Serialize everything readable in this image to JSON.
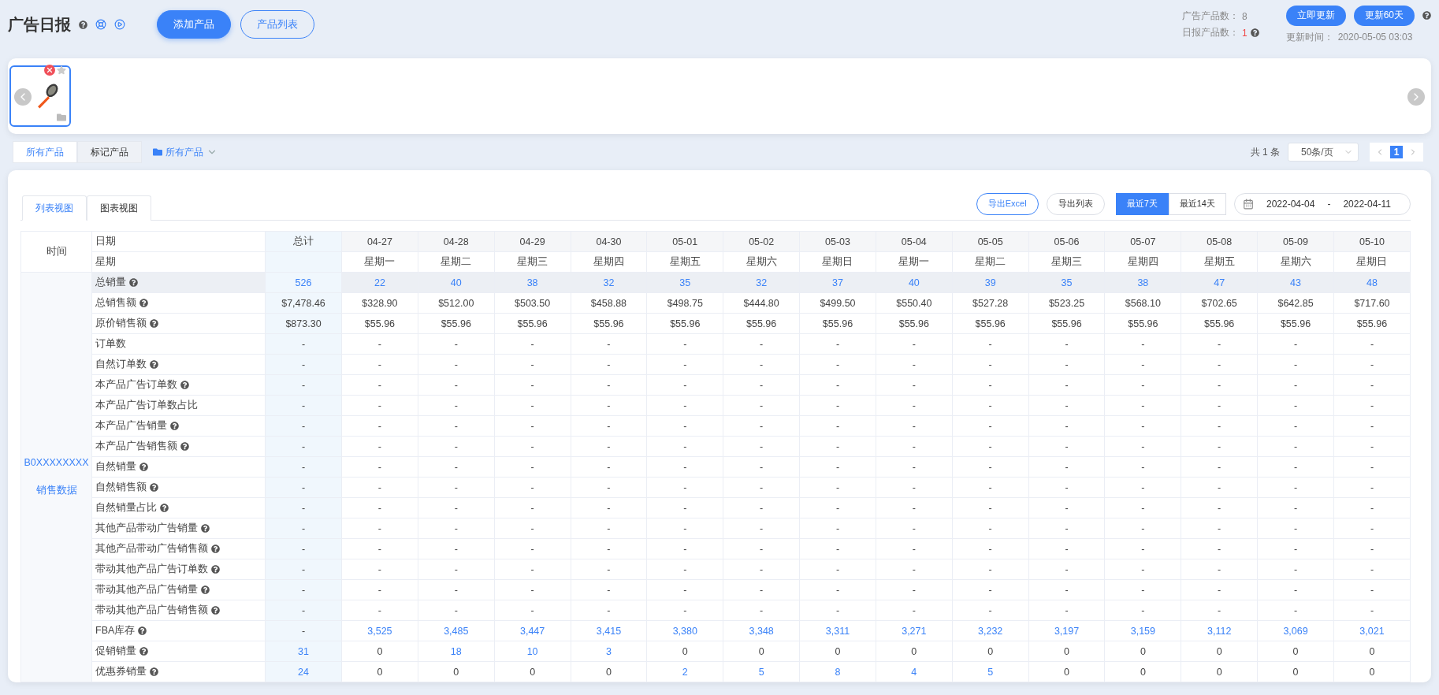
{
  "header": {
    "title": "广告日报",
    "buttons": [
      {
        "label": "添加产品",
        "primary": true
      },
      {
        "label": "产品列表",
        "primary": false
      }
    ],
    "stats": [
      {
        "label": "广告产品数：",
        "value": "8",
        "alert": false,
        "help": false
      },
      {
        "label": "日报产品数：",
        "value": "1",
        "alert": true,
        "help": true
      }
    ],
    "actions": [
      "立即更新",
      "更新60天"
    ],
    "update_label": "更新时间：",
    "update_time": "2020-05-05 03:03"
  },
  "products": [
    {
      "selected": true,
      "starred": false
    }
  ],
  "filter": {
    "tabs": [
      {
        "label": "所有产品",
        "selected": true
      },
      {
        "label": "标记产品",
        "selected": false
      }
    ],
    "folder": "所有产品",
    "total": "共 1 条",
    "page_size": "50条/页",
    "pages": [
      {
        "label": "1",
        "selected": true
      }
    ]
  },
  "view": {
    "tabs": [
      {
        "label": "列表视图",
        "selected": true
      },
      {
        "label": "图表视图",
        "selected": false
      }
    ],
    "exports": [
      {
        "label": "导出Excel",
        "primary": true
      },
      {
        "label": "导出列表",
        "primary": false
      }
    ],
    "ranges": [
      {
        "label": "最近7天",
        "selected": true
      },
      {
        "label": "最近14天",
        "selected": false
      }
    ],
    "date_start": "2022-04-04",
    "date_separator": "-",
    "date_end": "2022-04-11"
  },
  "table": {
    "corner": "时间",
    "date_label": "日期",
    "weekday_label": "星期",
    "total_label": "总计",
    "dates": [
      "04-27",
      "04-28",
      "04-29",
      "04-30",
      "05-01",
      "05-02",
      "05-03",
      "05-04",
      "05-05",
      "05-06",
      "05-07",
      "05-08",
      "05-09",
      "05-10"
    ],
    "weekdays": [
      "星期一",
      "星期二",
      "星期三",
      "星期四",
      "星期五",
      "星期六",
      "星期日",
      "星期一",
      "星期二",
      "星期三",
      "星期四",
      "星期五",
      "星期六",
      "星期日"
    ],
    "group": {
      "product": "B0XXXXXXXX",
      "label": "销售数据"
    },
    "rows": [
      {
        "label": "总销量",
        "help": true,
        "highlight": true,
        "cells": [
          "526",
          "22",
          "40",
          "38",
          "32",
          "35",
          "32",
          "37",
          "40",
          "39",
          "35",
          "38",
          "47",
          "43",
          "48"
        ],
        "linked": [
          true,
          true,
          true,
          true,
          true,
          true,
          true,
          true,
          true,
          true,
          true,
          true,
          true,
          true,
          true
        ]
      },
      {
        "label": "总销售额",
        "help": true,
        "highlight": false,
        "cells": [
          "$7,478.46",
          "$328.90",
          "$512.00",
          "$503.50",
          "$458.88",
          "$498.75",
          "$444.80",
          "$499.50",
          "$550.40",
          "$527.28",
          "$523.25",
          "$568.10",
          "$702.65",
          "$642.85",
          "$717.60"
        ]
      },
      {
        "label": "原价销售额",
        "help": true,
        "highlight": false,
        "cells": [
          "$873.30",
          "$55.96",
          "$55.96",
          "$55.96",
          "$55.96",
          "$55.96",
          "$55.96",
          "$55.96",
          "$55.96",
          "$55.96",
          "$55.96",
          "$55.96",
          "$55.96",
          "$55.96",
          "$55.96"
        ]
      },
      {
        "label": "订单数",
        "help": false,
        "highlight": false,
        "cells": [
          "-",
          "-",
          "-",
          "-",
          "-",
          "-",
          "-",
          "-",
          "-",
          "-",
          "-",
          "-",
          "-",
          "-",
          "-"
        ]
      },
      {
        "label": "自然订单数",
        "help": true,
        "highlight": false,
        "cells": [
          "-",
          "-",
          "-",
          "-",
          "-",
          "-",
          "-",
          "-",
          "-",
          "-",
          "-",
          "-",
          "-",
          "-",
          "-"
        ]
      },
      {
        "label": "本产品广告订单数",
        "help": true,
        "highlight": false,
        "cells": [
          "-",
          "-",
          "-",
          "-",
          "-",
          "-",
          "-",
          "-",
          "-",
          "-",
          "-",
          "-",
          "-",
          "-",
          "-"
        ]
      },
      {
        "label": "本产品广告订单数占比",
        "help": false,
        "highlight": false,
        "cells": [
          "-",
          "-",
          "-",
          "-",
          "-",
          "-",
          "-",
          "-",
          "-",
          "-",
          "-",
          "-",
          "-",
          "-",
          "-"
        ]
      },
      {
        "label": "本产品广告销量",
        "help": true,
        "highlight": false,
        "cells": [
          "-",
          "-",
          "-",
          "-",
          "-",
          "-",
          "-",
          "-",
          "-",
          "-",
          "-",
          "-",
          "-",
          "-",
          "-"
        ]
      },
      {
        "label": "本产品广告销售额",
        "help": true,
        "highlight": false,
        "cells": [
          "-",
          "-",
          "-",
          "-",
          "-",
          "-",
          "-",
          "-",
          "-",
          "-",
          "-",
          "-",
          "-",
          "-",
          "-"
        ]
      },
      {
        "label": "自然销量",
        "help": true,
        "highlight": false,
        "cells": [
          "-",
          "-",
          "-",
          "-",
          "-",
          "-",
          "-",
          "-",
          "-",
          "-",
          "-",
          "-",
          "-",
          "-",
          "-"
        ]
      },
      {
        "label": "自然销售额",
        "help": true,
        "highlight": false,
        "cells": [
          "-",
          "-",
          "-",
          "-",
          "-",
          "-",
          "-",
          "-",
          "-",
          "-",
          "-",
          "-",
          "-",
          "-",
          "-"
        ]
      },
      {
        "label": "自然销量占比",
        "help": true,
        "highlight": false,
        "cells": [
          "-",
          "-",
          "-",
          "-",
          "-",
          "-",
          "-",
          "-",
          "-",
          "-",
          "-",
          "-",
          "-",
          "-",
          "-"
        ]
      },
      {
        "label": "其他产品带动广告销量",
        "help": true,
        "highlight": false,
        "cells": [
          "-",
          "-",
          "-",
          "-",
          "-",
          "-",
          "-",
          "-",
          "-",
          "-",
          "-",
          "-",
          "-",
          "-",
          "-"
        ]
      },
      {
        "label": "其他产品带动广告销售额",
        "help": true,
        "highlight": false,
        "cells": [
          "-",
          "-",
          "-",
          "-",
          "-",
          "-",
          "-",
          "-",
          "-",
          "-",
          "-",
          "-",
          "-",
          "-",
          "-"
        ]
      },
      {
        "label": "带动其他产品广告订单数",
        "help": true,
        "highlight": false,
        "cells": [
          "-",
          "-",
          "-",
          "-",
          "-",
          "-",
          "-",
          "-",
          "-",
          "-",
          "-",
          "-",
          "-",
          "-",
          "-"
        ]
      },
      {
        "label": "带动其他产品广告销量",
        "help": true,
        "highlight": false,
        "cells": [
          "-",
          "-",
          "-",
          "-",
          "-",
          "-",
          "-",
          "-",
          "-",
          "-",
          "-",
          "-",
          "-",
          "-",
          "-"
        ]
      },
      {
        "label": "带动其他产品广告销售额",
        "help": true,
        "highlight": false,
        "cells": [
          "-",
          "-",
          "-",
          "-",
          "-",
          "-",
          "-",
          "-",
          "-",
          "-",
          "-",
          "-",
          "-",
          "-",
          "-"
        ]
      },
      {
        "label": "FBA库存",
        "help": true,
        "highlight": false,
        "cells": [
          "-",
          "3,525",
          "3,485",
          "3,447",
          "3,415",
          "3,380",
          "3,348",
          "3,311",
          "3,271",
          "3,232",
          "3,197",
          "3,159",
          "3,112",
          "3,069",
          "3,021"
        ],
        "linked": [
          false,
          true,
          true,
          true,
          true,
          true,
          true,
          true,
          true,
          true,
          true,
          true,
          true,
          true,
          true
        ]
      },
      {
        "label": "促销销量",
        "help": true,
        "highlight": false,
        "cells": [
          "31",
          "0",
          "18",
          "10",
          "3",
          "0",
          "0",
          "0",
          "0",
          "0",
          "0",
          "0",
          "0",
          "0",
          "0"
        ],
        "linked": [
          true,
          false,
          true,
          true,
          true,
          false,
          false,
          false,
          false,
          false,
          false,
          false,
          false,
          false,
          false
        ]
      },
      {
        "label": "优惠券销量",
        "help": true,
        "highlight": false,
        "cells": [
          "24",
          "0",
          "0",
          "0",
          "0",
          "2",
          "5",
          "8",
          "4",
          "5",
          "0",
          "0",
          "0",
          "0",
          "0"
        ],
        "linked": [
          true,
          false,
          false,
          false,
          false,
          true,
          true,
          true,
          true,
          true,
          false,
          false,
          false,
          false,
          false
        ]
      }
    ]
  }
}
